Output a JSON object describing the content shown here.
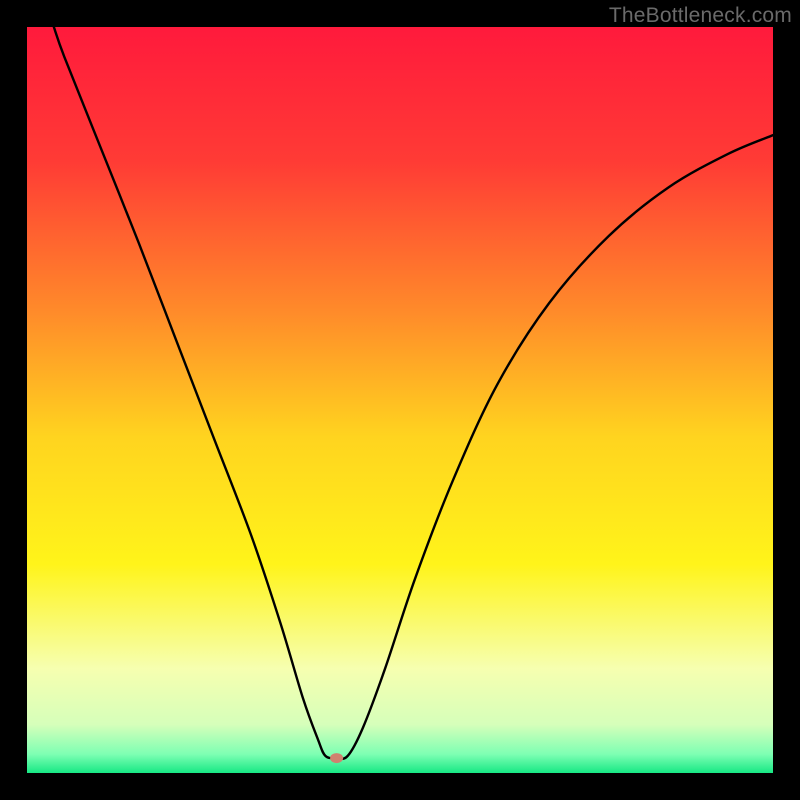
{
  "watermark": "TheBottleneck.com",
  "chart_data": {
    "type": "line",
    "title": "",
    "xlabel": "",
    "ylabel": "",
    "xlim": [
      0,
      100
    ],
    "ylim": [
      0,
      100
    ],
    "gradient_stops": [
      {
        "offset": 0.0,
        "color": "#ff1a3c"
      },
      {
        "offset": 0.18,
        "color": "#ff3b35"
      },
      {
        "offset": 0.38,
        "color": "#ff8a2a"
      },
      {
        "offset": 0.55,
        "color": "#ffd41f"
      },
      {
        "offset": 0.72,
        "color": "#fff41a"
      },
      {
        "offset": 0.86,
        "color": "#f6ffb0"
      },
      {
        "offset": 0.935,
        "color": "#d6ffba"
      },
      {
        "offset": 0.975,
        "color": "#7dffb3"
      },
      {
        "offset": 1.0,
        "color": "#17e884"
      }
    ],
    "dip_point": {
      "x": 41.5,
      "y": 2.0
    },
    "series": [
      {
        "name": "curve",
        "points": [
          {
            "x": 3.6,
            "y": 100.0
          },
          {
            "x": 5.0,
            "y": 96.0
          },
          {
            "x": 9.0,
            "y": 86.0
          },
          {
            "x": 15.0,
            "y": 71.0
          },
          {
            "x": 20.0,
            "y": 58.0
          },
          {
            "x": 25.0,
            "y": 45.0
          },
          {
            "x": 30.0,
            "y": 32.0
          },
          {
            "x": 34.0,
            "y": 20.0
          },
          {
            "x": 37.0,
            "y": 10.0
          },
          {
            "x": 39.0,
            "y": 4.5
          },
          {
            "x": 40.0,
            "y": 2.3
          },
          {
            "x": 41.5,
            "y": 2.0
          },
          {
            "x": 43.0,
            "y": 2.3
          },
          {
            "x": 45.0,
            "y": 6.0
          },
          {
            "x": 48.0,
            "y": 14.0
          },
          {
            "x": 52.0,
            "y": 26.0
          },
          {
            "x": 57.0,
            "y": 39.0
          },
          {
            "x": 63.0,
            "y": 52.0
          },
          {
            "x": 70.0,
            "y": 63.0
          },
          {
            "x": 78.0,
            "y": 72.0
          },
          {
            "x": 86.0,
            "y": 78.5
          },
          {
            "x": 94.0,
            "y": 83.0
          },
          {
            "x": 100.0,
            "y": 85.5
          }
        ]
      }
    ]
  }
}
